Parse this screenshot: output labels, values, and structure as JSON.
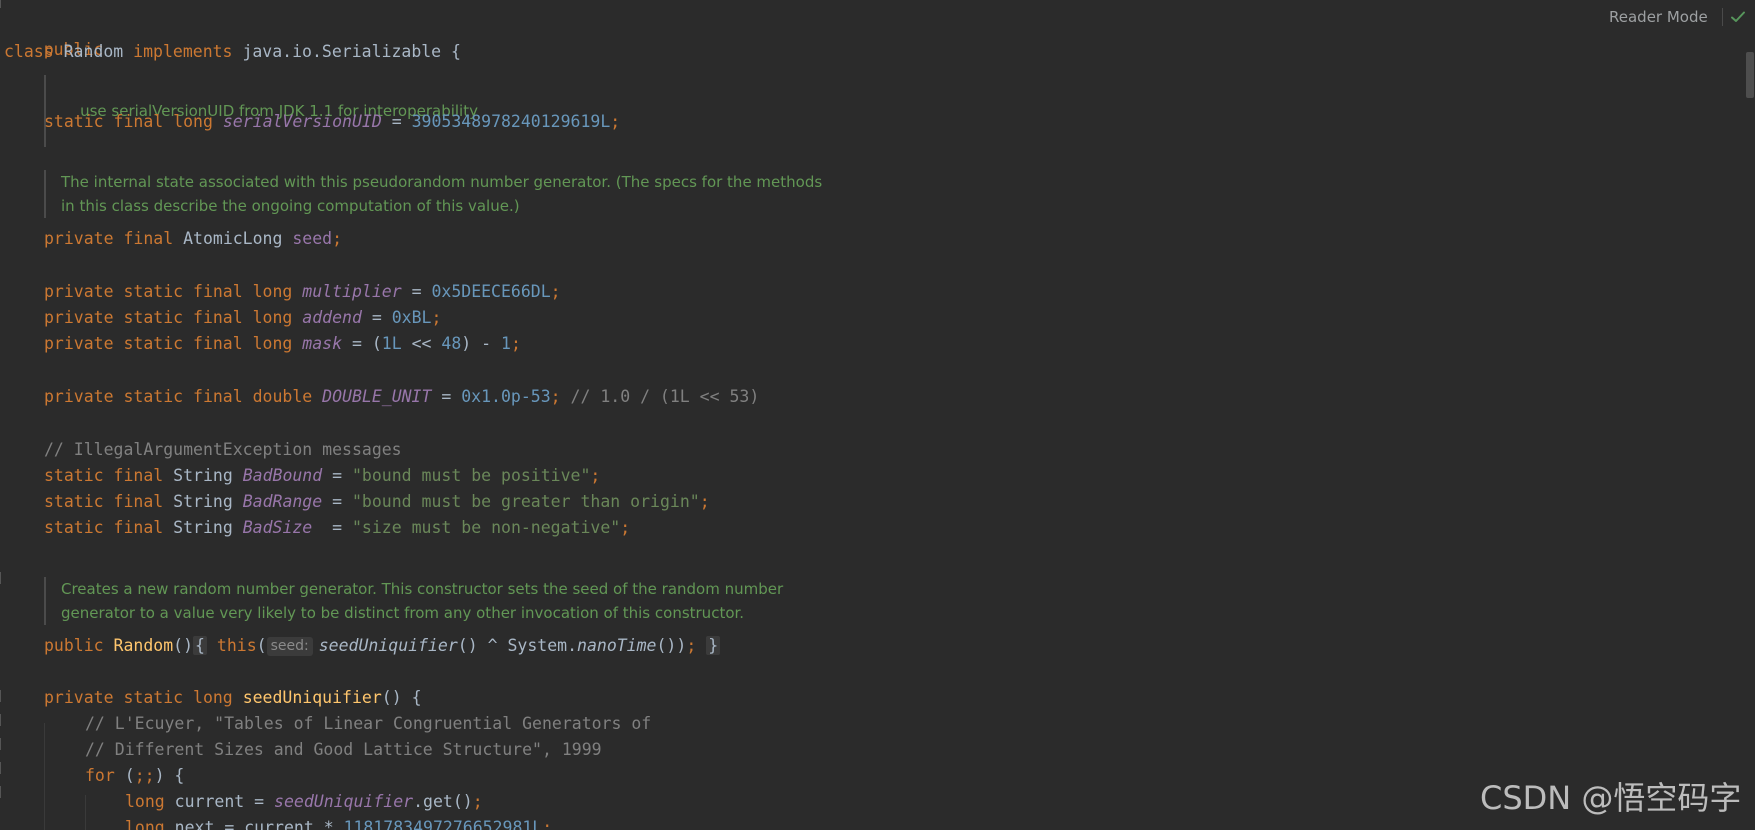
{
  "toolbar": {
    "reader_mode_label": "Reader Mode",
    "inspection_icon": "check-icon",
    "inspection_color": "#57965c"
  },
  "code": {
    "public_kw": "public",
    "class_kw": "class",
    "class_name": "Random",
    "implements_kw": "implements",
    "interface": "java.io.Serializable",
    "open_brace": " {",
    "doc_serial": "use serialVersionUID from JDK 1.1 for interoperability",
    "static_final_long": "static final long",
    "serial_field": "serialVersionUID",
    "equals": " = ",
    "serial_value": "3905348978240129619L",
    "semicolon": ";",
    "doc_seed_1": "The internal state associated with this pseudorandom number generator. (The specs for the methods",
    "doc_seed_2": "in this class describe the ongoing computation of this value.)",
    "private_final": "private final",
    "atomic_type": "AtomicLong",
    "seed_field": "seed",
    "private_static_final_long": "private static final long",
    "multiplier_field": "multiplier",
    "multiplier_value": "0x5DEECE66DL",
    "addend_field": "addend",
    "addend_value": "0xBL",
    "mask_field": "mask",
    "mask_open": " = (",
    "mask_a": "1L",
    "mask_op": " << ",
    "mask_b": "48",
    "mask_close": ") - ",
    "mask_c": "1",
    "private_static_final_double": "private static final double",
    "double_unit_field": "DOUBLE_UNIT",
    "double_unit_value": "0x1.0p-53",
    "double_unit_comment": "// 1.0 / (1L << 53)",
    "iae_comment": "// IllegalArgumentException messages",
    "static_final": "static final",
    "string_type": "String",
    "bad_bound_field": "BadBound",
    "bad_bound_value": "\"bound must be positive\"",
    "bad_range_field": "BadRange",
    "bad_range_value": "\"bound must be greater than origin\"",
    "bad_size_field": "BadSize",
    "bad_size_eq": "  = ",
    "bad_size_value": "\"size must be non-negative\"",
    "doc_ctor_1": "Creates a new random number generator. This constructor sets the seed of the random number",
    "doc_ctor_2": "generator to a value very likely to be distinct from any other invocation of this constructor.",
    "public_kw2": "public",
    "ctor_name": "Random",
    "parens": "()",
    "fold_open": "{",
    "this_kw": "this",
    "open_paren": "(",
    "seed_hint": "seed:",
    "seed_uniq_call": "seedUniquifier",
    "call_rest": "() ^ System.",
    "nano_time": "nanoTime",
    "call_end": "())",
    "fold_close": "}",
    "private_static_long": "private static long",
    "seed_uniq_decl": "seedUniquifier",
    "decl_rest": "() {",
    "lecuyer_comment_1": "// L'Ecuyer, \"Tables of Linear Congruential Generators of",
    "lecuyer_comment_2": "// Different Sizes and Good Lattice Structure\", 1999",
    "for_kw": "for",
    "for_open": " (",
    "for_semis": ";;",
    "for_close": ") {",
    "long_kw": "long",
    "current_decl": " current = ",
    "seed_uniq_field": "seedUniquifier",
    "get_call": ".get()",
    "next_decl": " next = current * ",
    "next_value": "1181783497276652981L"
  },
  "watermark": {
    "text": "CSDN @悟空码字"
  }
}
